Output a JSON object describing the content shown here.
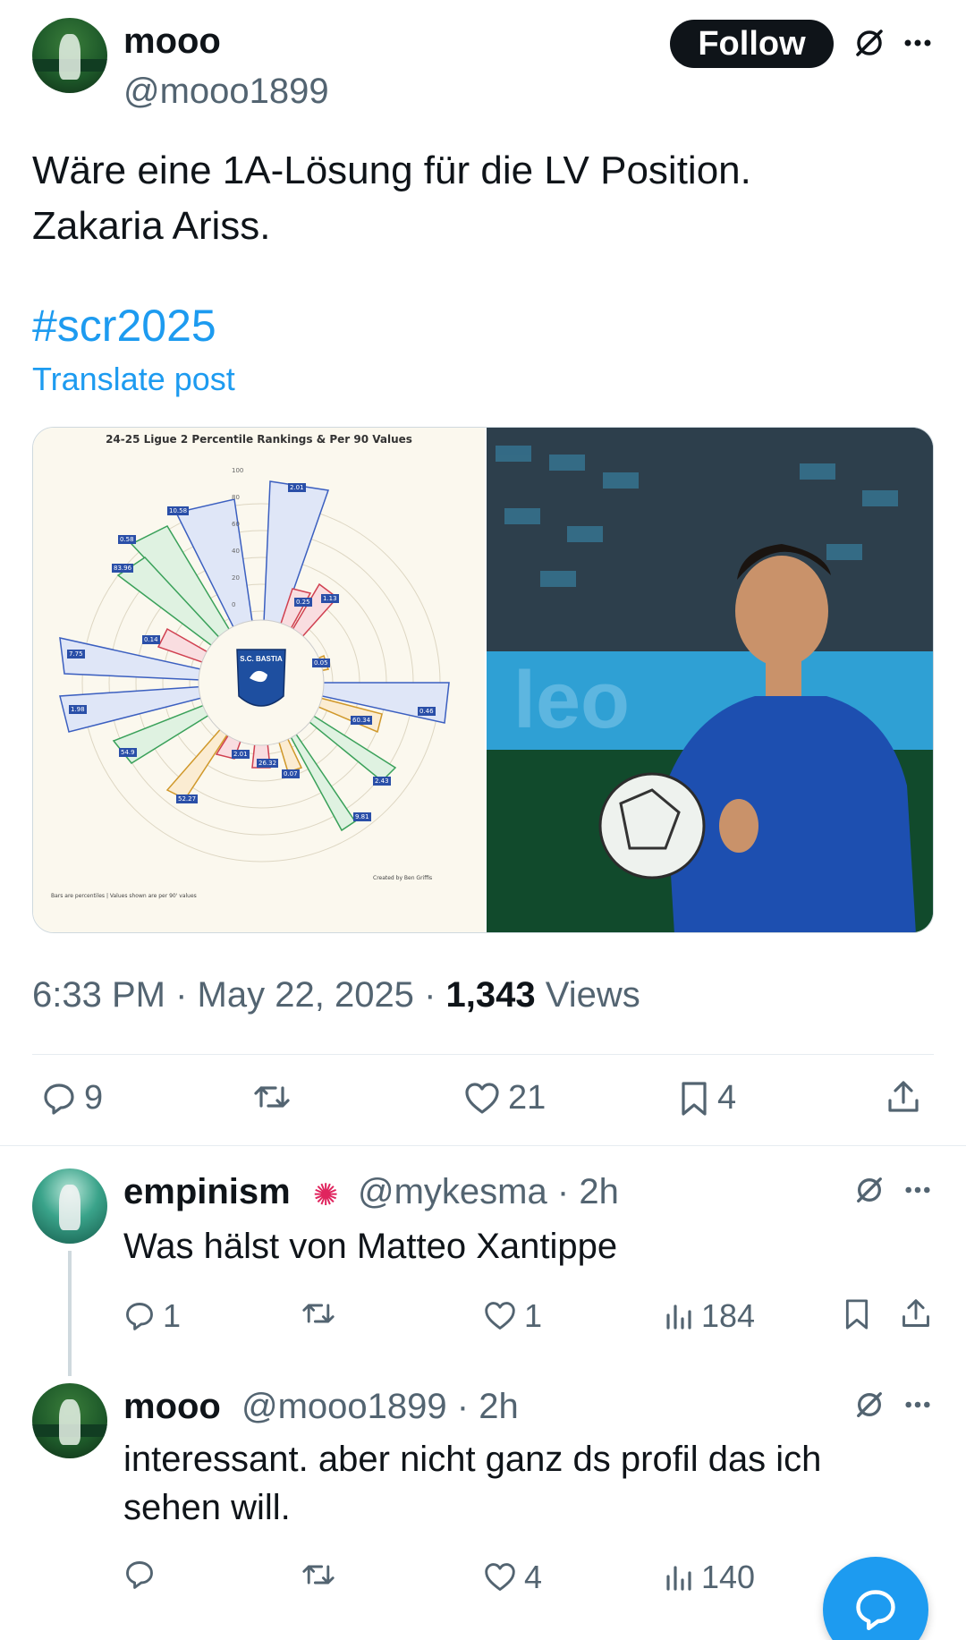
{
  "post": {
    "author_name": "mooo",
    "author_handle": "@mooo1899",
    "follow_label": "Follow",
    "text_line1": "Wäre eine 1A-Lösung für die LV Position.",
    "text_line2": "Zakaria Ariss.",
    "hashtag": "#scr2025",
    "translate_label": "Translate post",
    "time": "6:33 PM",
    "date": "May 22, 2025",
    "views_count": "1,343",
    "views_label": "Views",
    "replies": "9",
    "likes": "21",
    "bookmarks": "4"
  },
  "chart_image": {
    "title": "24-25 Ligue 2 Percentile Rankings & Per 90 Values",
    "club_badge": "S.C. BASTIA",
    "note_left": "Bars are percentiles | Values shown are per 90' values",
    "note_right": "Created by Ben Griffis",
    "ticks": [
      "100",
      "80",
      "60",
      "40",
      "20",
      "0"
    ],
    "value_labels": [
      "10.58",
      "0.58",
      "83.96",
      "0.14",
      "7.75",
      "1.98",
      "54.9",
      "2.01",
      "0.25",
      "1.13",
      "0.05",
      "0.46",
      "60.34",
      "2.43",
      "9.81",
      "0.07",
      "26.32",
      "2.01",
      "52.27"
    ]
  },
  "replies": [
    {
      "name": "empinism",
      "handle": "@mykesma",
      "age": "2h",
      "text": "Was hälst von Matteo Xantippe",
      "replies": "1",
      "likes": "1",
      "views": "184"
    },
    {
      "name": "mooo",
      "handle": "@mooo1899",
      "age": "2h",
      "text_line1": "interessant. aber nicht ganz ds profil das ich",
      "text_line2": "sehen will.",
      "likes": "4",
      "views": "140"
    }
  ],
  "colors": {
    "accent": "#1d9bf0",
    "text": "#0f1419",
    "muted": "#536471"
  },
  "icons": [
    "grok-icon",
    "more-icon",
    "reply-icon",
    "retweet-icon",
    "like-icon",
    "bookmark-icon",
    "share-icon",
    "views-icon",
    "compose-reply-icon"
  ]
}
